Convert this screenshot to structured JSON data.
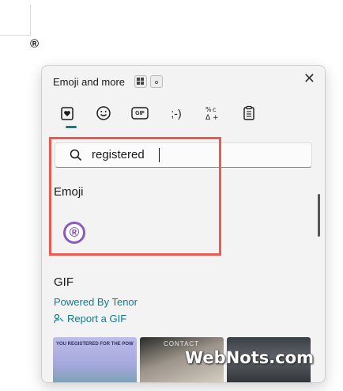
{
  "document": {
    "registered_char": "®"
  },
  "panel": {
    "title": "Emoji and more",
    "close_glyph": "✕",
    "tabs": [
      {
        "name": "favorites",
        "icon": "heart-icon"
      },
      {
        "name": "emoji",
        "icon": "smiley-icon"
      },
      {
        "name": "gif",
        "label": "GIF"
      },
      {
        "name": "kaomoji",
        "label": ";-)"
      },
      {
        "name": "symbols",
        "icon": "symbols-icon"
      },
      {
        "name": "clipboard",
        "icon": "clipboard-icon"
      }
    ],
    "search": {
      "value": "registered"
    },
    "emoji_section": {
      "heading": "Emoji",
      "results": [
        "®"
      ]
    },
    "gif_section": {
      "heading": "GIF",
      "powered_by": "Powered By Tenor",
      "report": "Report a GIF",
      "thumbnail_captions": [
        "YOU REGISTERED FOR THE POW",
        "CONTACT"
      ]
    }
  },
  "watermark": "WebNots.com",
  "colors": {
    "accent": "#0e7a8a",
    "highlight": "#ee5a50",
    "emoji_purple": "#8a5cc0"
  }
}
